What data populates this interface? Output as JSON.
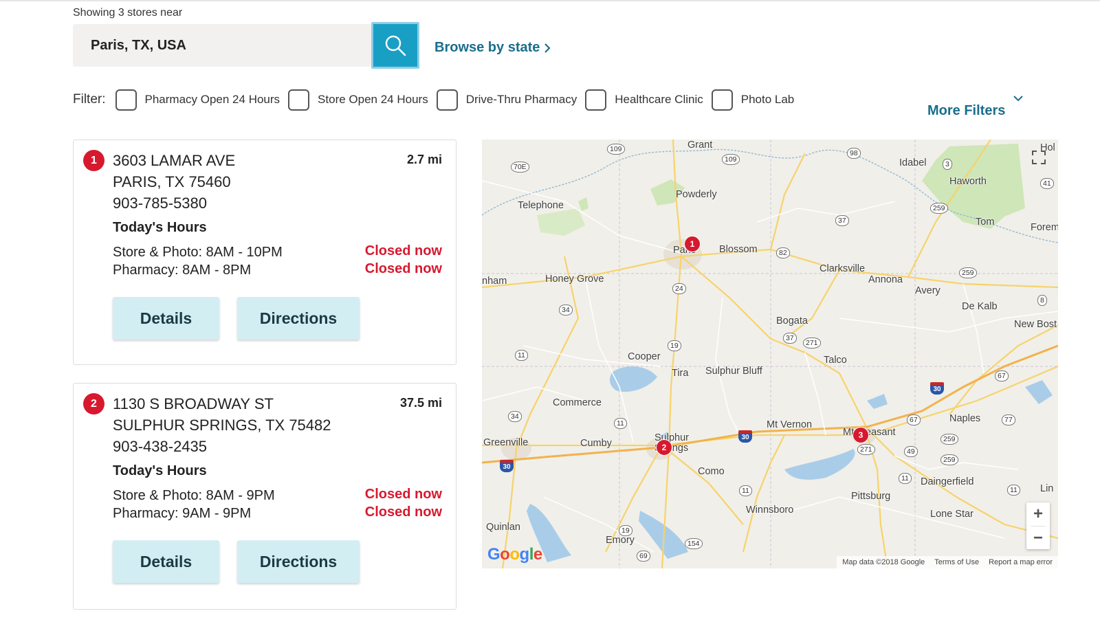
{
  "header": {
    "showing_text": "Showing 3 stores near",
    "search_value": "Paris, TX, USA",
    "browse_label": "Browse by state"
  },
  "filters": {
    "label": "Filter:",
    "items": [
      {
        "label": "Pharmacy Open 24 Hours"
      },
      {
        "label": "Store Open 24 Hours"
      },
      {
        "label": "Drive-Thru Pharmacy"
      },
      {
        "label": "Healthcare Clinic"
      },
      {
        "label": "Photo Lab"
      }
    ],
    "more_label": "More Filters"
  },
  "stores": [
    {
      "number": "1",
      "address_line1": "3603 LAMAR AVE",
      "address_line2": "PARIS, TX 75460",
      "phone": "903-785-5380",
      "distance": "2.7 mi",
      "hours_title": "Today's Hours",
      "store_photo_hours": "Store & Photo: 8AM - 10PM",
      "pharmacy_hours": "Pharmacy: 8AM - 8PM",
      "store_status": "Closed now",
      "pharmacy_status": "Closed now",
      "details_label": "Details",
      "directions_label": "Directions"
    },
    {
      "number": "2",
      "address_line1": "1130 S BROADWAY ST",
      "address_line2": "SULPHUR SPRINGS, TX 75482",
      "phone": "903-438-2435",
      "distance": "37.5 mi",
      "hours_title": "Today's Hours",
      "store_photo_hours": "Store & Photo: 8AM - 9PM",
      "pharmacy_hours": "Pharmacy: 9AM - 9PM",
      "store_status": "Closed now",
      "pharmacy_status": "Closed now",
      "details_label": "Details",
      "directions_label": "Directions"
    }
  ],
  "map": {
    "pins": [
      "1",
      "2",
      "3"
    ],
    "places": {
      "grant": "Grant",
      "hol": "Hol",
      "idabel": "Idabel",
      "haworth": "Haworth",
      "powderly": "Powderly",
      "telephone": "Telephone",
      "tom": "Tom",
      "forem": "Forem",
      "paris": "Paris",
      "blossom": "Blossom",
      "clarksville": "Clarksville",
      "annona": "Annona",
      "avery": "Avery",
      "nham": "nham",
      "honey_grove": "Honey Grove",
      "de_kalb": "De Kalb",
      "new_bost": "New Bost",
      "bogata": "Bogata",
      "cooper": "Cooper",
      "talco": "Talco",
      "tira": "Tira",
      "sulphur_bluff": "Sulphur Bluff",
      "commerce": "Commerce",
      "mt_vernon": "Mt Vernon",
      "naples": "Naples",
      "greenville": "Greenville",
      "cumby": "Cumby",
      "sulphur_springs_a": "Sulphur",
      "sulphur_springs_b": "Springs",
      "mt_pleasant": "Mt Pleasant",
      "como": "Como",
      "daingerfield": "Daingerfield",
      "lin": "Lin",
      "pittsburg": "Pittsburg",
      "winnsboro": "Winnsboro",
      "lone_star": "Lone Star",
      "quinlan": "Quinlan",
      "emory": "Emory"
    },
    "highways": {
      "h109a": "109",
      "h109b": "109",
      "h70e": "70E",
      "h98": "98",
      "h3": "3",
      "h41": "41",
      "h259a": "259",
      "h37a": "37",
      "h82": "82",
      "h259b": "259",
      "h24": "24",
      "h34a": "34",
      "h8": "8",
      "h37b": "37",
      "h271a": "271",
      "h19a": "19",
      "h11a": "11",
      "h67a": "67",
      "h34b": "34",
      "h11b": "11",
      "h67b": "67",
      "h77": "77",
      "h259c": "259",
      "h271b": "271",
      "h49": "49",
      "h259d": "259",
      "h11c": "11",
      "h11d": "11",
      "h11e": "11",
      "h19b": "19",
      "h154": "154",
      "h69": "69",
      "i30a": "30",
      "i30b": "30",
      "i30c": "30"
    },
    "attribution": {
      "map_data": "Map data ©2018 Google",
      "terms": "Terms of Use",
      "report": "Report a map error"
    },
    "logo": "Google",
    "zoom_in": "+",
    "zoom_out": "−"
  },
  "colors": {
    "accent": "#1a9fc4",
    "link": "#1a6e8c",
    "closed": "#d7192f",
    "button_bg": "#d3eef3",
    "pin": "#d7192f"
  }
}
